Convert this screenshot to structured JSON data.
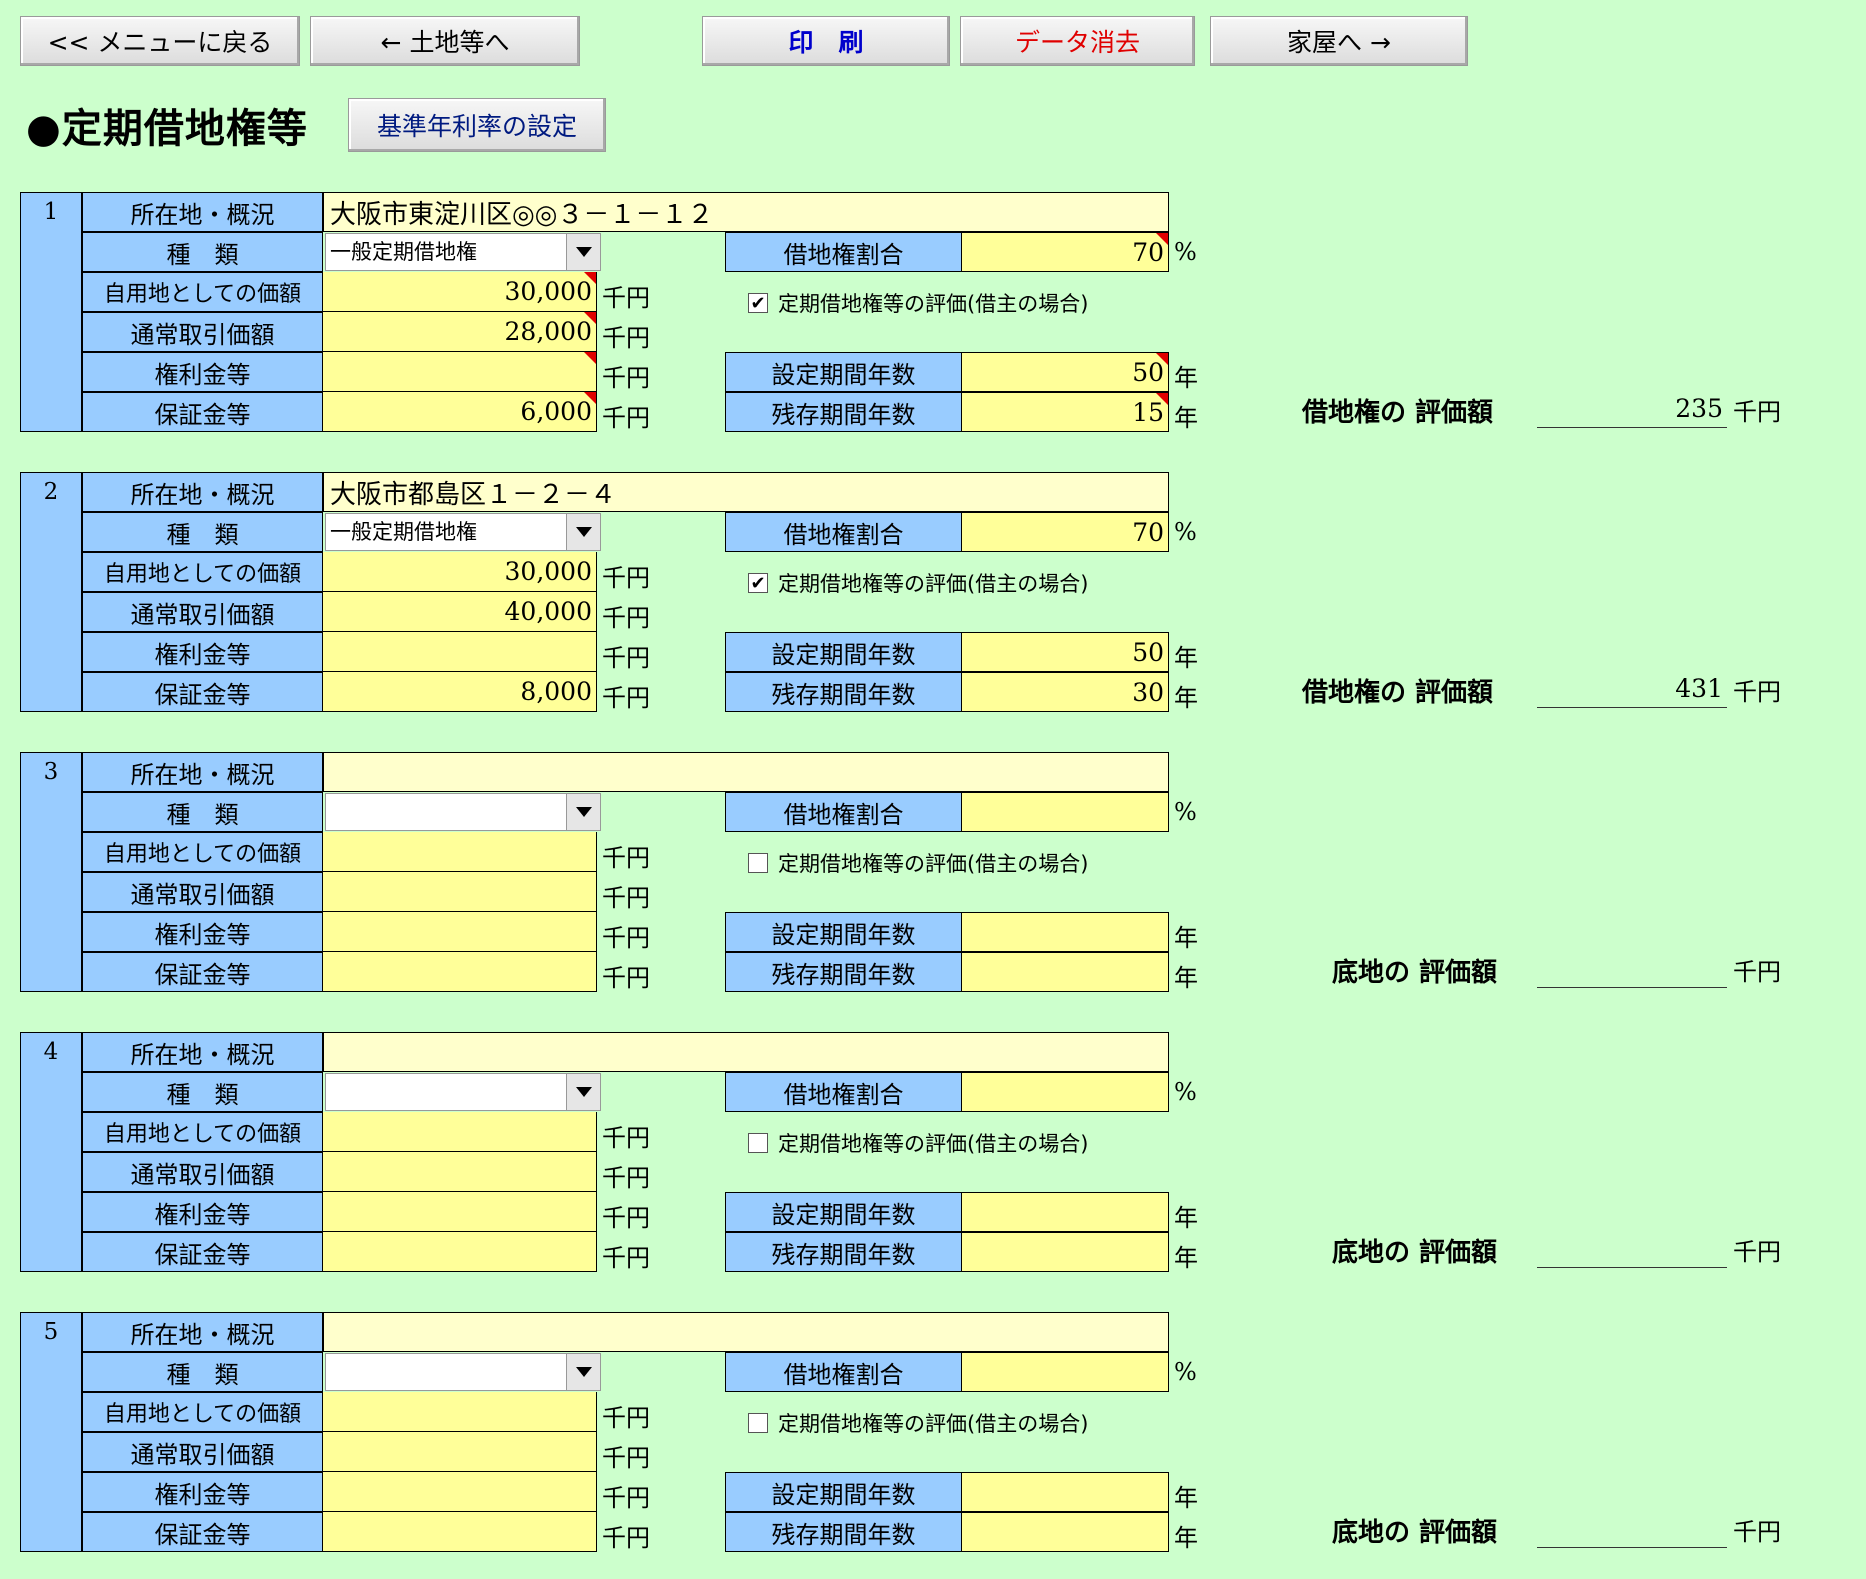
{
  "toolbar": {
    "back_menu": "<< メニューに戻る",
    "to_land": "← 土地等へ",
    "print": "印　刷",
    "clear_data": "データ消去",
    "to_house": "家屋へ →"
  },
  "page_title": "●定期借地権等",
  "rate_button": "基準年利率の設定",
  "labels": {
    "location": "所在地・概況",
    "type": "種　類",
    "self_use_value": "自用地としての価額",
    "normal_price": "通常取引価額",
    "premium": "権利金等",
    "deposit": "保証金等",
    "leasehold_ratio": "借地権割合",
    "checkbox": "定期借地権等の評価(借主の場合)",
    "set_period": "設定期間年数",
    "remaining_period": "残存期間年数",
    "unit_thousand_yen": "千円",
    "unit_percent": "%",
    "unit_year": "年"
  },
  "sections": [
    {
      "no": "1",
      "address": "大阪市東淀川区◎◎３－１－１２",
      "type": "一般定期借地権",
      "self_use_value": "30,000",
      "normal_price": "28,000",
      "premium": "",
      "deposit": "6,000",
      "leasehold_ratio": "70",
      "checked": true,
      "check_mark": "✔",
      "set_period": "50",
      "remaining_period": "15",
      "result_label": "借地権の 評価額",
      "result_value": "235"
    },
    {
      "no": "2",
      "address": "大阪市都島区１－２－４",
      "type": "一般定期借地権",
      "self_use_value": "30,000",
      "normal_price": "40,000",
      "premium": "",
      "deposit": "8,000",
      "leasehold_ratio": "70",
      "checked": true,
      "check_mark": "✔",
      "set_period": "50",
      "remaining_period": "30",
      "result_label": "借地権の 評価額",
      "result_value": "431"
    },
    {
      "no": "3",
      "address": "",
      "type": "",
      "self_use_value": "",
      "normal_price": "",
      "premium": "",
      "deposit": "",
      "leasehold_ratio": "",
      "checked": false,
      "check_mark": "",
      "set_period": "",
      "remaining_period": "",
      "result_label": "底地の 評価額",
      "result_value": ""
    },
    {
      "no": "4",
      "address": "",
      "type": "",
      "self_use_value": "",
      "normal_price": "",
      "premium": "",
      "deposit": "",
      "leasehold_ratio": "",
      "checked": false,
      "check_mark": "",
      "set_period": "",
      "remaining_period": "",
      "result_label": "底地の 評価額",
      "result_value": ""
    },
    {
      "no": "5",
      "address": "",
      "type": "",
      "self_use_value": "",
      "normal_price": "",
      "premium": "",
      "deposit": "",
      "leasehold_ratio": "",
      "checked": false,
      "check_mark": "",
      "set_period": "",
      "remaining_period": "",
      "result_label": "底地の 評価額",
      "result_value": ""
    }
  ],
  "colors": {
    "background": "#ccffcc",
    "label_blue": "#99ccff",
    "input_yellow": "#ffff99",
    "address_yellow": "#ffffcc",
    "print_text": "#0000cc",
    "clear_text": "#e00000",
    "comment_marker": "#e00000"
  }
}
